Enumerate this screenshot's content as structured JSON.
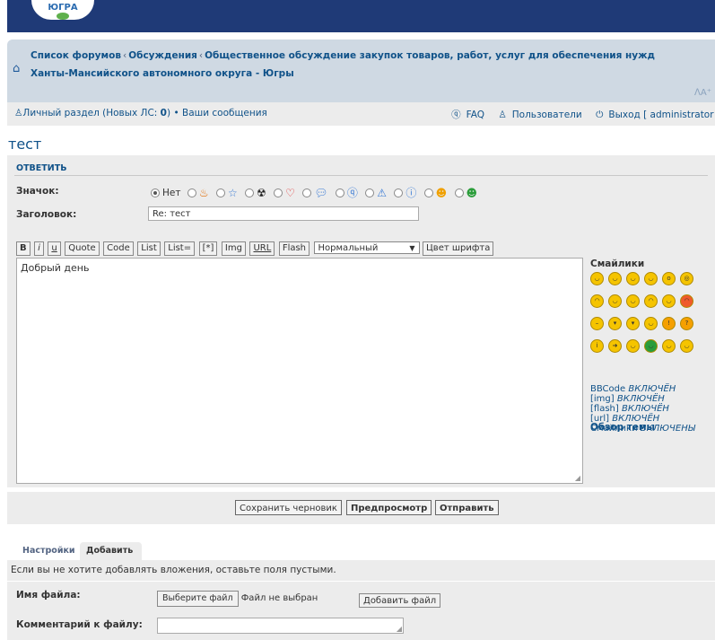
{
  "header": {
    "logo_text": "ЮГРА"
  },
  "breadcrumbs": [
    "Список форумов",
    "Обсуждения",
    "Общественное обсуждение закупок товаров, работ, услуг для обеспечения нужд Ханты-Мансийского автономного округа - Югры"
  ],
  "breadcrumb_separator": "‹",
  "userbar": {
    "personal": "Личный раздел (Новых ЛС: ",
    "new_count": "0",
    "personal_end": ")",
    "bullet": "•",
    "messages": "Ваши сообщения",
    "faq": "FAQ",
    "users": "Пользователи",
    "logout": "Выход [ administrator ]"
  },
  "topic_title": "тест",
  "post_form": {
    "reply_tab": "ОТВЕТИТЬ",
    "icon_label": "Значок:",
    "icon_none": "Нет",
    "subject_label": "Заголовок:",
    "subject_value": "Re: тест",
    "toolbar": [
      "B",
      "i",
      "u",
      "Quote",
      "Code",
      "List",
      "List=",
      "[*]",
      "Img",
      "URL",
      "Flash"
    ],
    "font_size_select": "Нормальный",
    "font_color_button": "Цвет шрифта",
    "message": "Добрый день"
  },
  "smilies": {
    "title": "Смайлики",
    "status": [
      {
        "name": "BBCode",
        "value": "ВКЛЮЧЁН"
      },
      {
        "name": "[img]",
        "value": "ВКЛЮЧЁН"
      },
      {
        "name": "[flash]",
        "value": "ВКЛЮЧЁН"
      },
      {
        "name": "[url]",
        "value": "ВКЛЮЧЁН"
      },
      {
        "name": "Смайлики",
        "value": "ВКЛЮЧЕНЫ"
      }
    ],
    "topic_overview": "Обзор темы"
  },
  "buttons": {
    "save_draft": "Сохранить черновик",
    "preview": "Предпросмотр",
    "submit": "Отправить"
  },
  "tabs": {
    "settings": "Настройки",
    "attachments": "Добавить вложения"
  },
  "attachments": {
    "note": "Если вы не хотите добавлять вложения, оставьте поля пустыми.",
    "filename_label": "Имя файла:",
    "choose_file": "Выберите файл",
    "no_file": "Файл не выбран",
    "add_file": "Добавить файл",
    "comment_label": "Комментарий к файлу:"
  },
  "colors": {
    "header": "#1f3a77",
    "link": "#105289",
    "panel": "#ececec",
    "navbar": "#cfd9e3"
  }
}
